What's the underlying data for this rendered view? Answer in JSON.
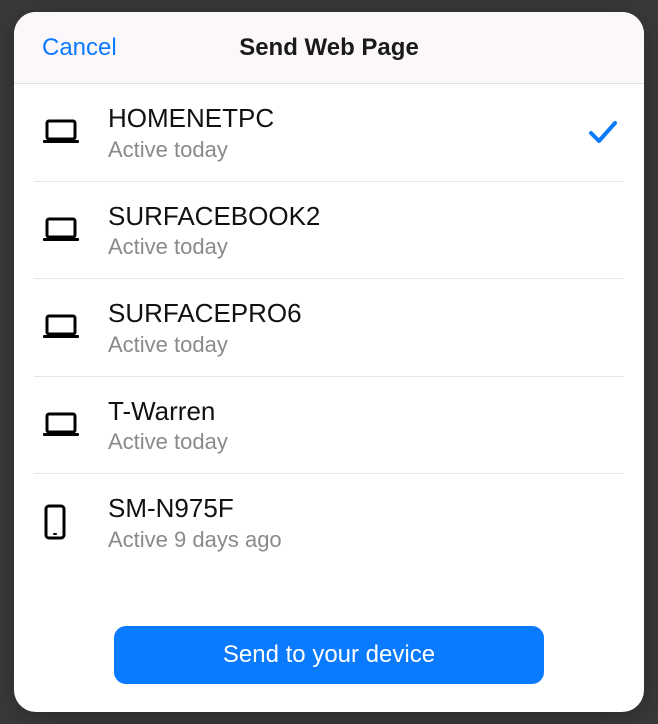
{
  "header": {
    "cancel_label": "Cancel",
    "title": "Send Web Page"
  },
  "devices": [
    {
      "name": "HOMENETPC",
      "status": "Active today",
      "type": "laptop",
      "selected": true
    },
    {
      "name": "SURFACEBOOK2",
      "status": "Active today",
      "type": "laptop",
      "selected": false
    },
    {
      "name": "SURFACEPRO6",
      "status": "Active today",
      "type": "laptop",
      "selected": false
    },
    {
      "name": "T-Warren",
      "status": "Active today",
      "type": "laptop",
      "selected": false
    },
    {
      "name": "SM-N975F",
      "status": "Active 9 days ago",
      "type": "phone",
      "selected": false
    }
  ],
  "footer": {
    "send_label": "Send to your device"
  },
  "colors": {
    "accent": "#0a7aff"
  }
}
